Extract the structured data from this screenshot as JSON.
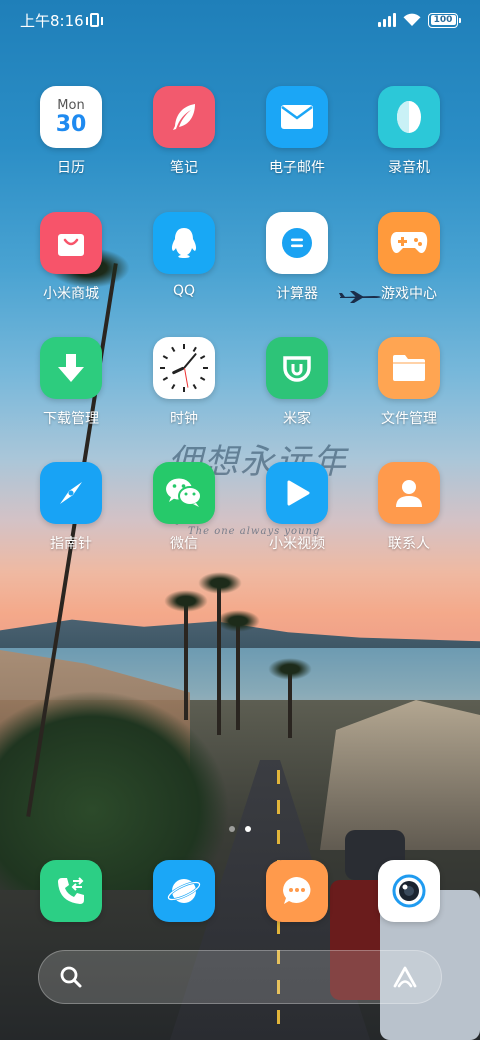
{
  "status_bar": {
    "time": "上午8:16",
    "battery": "100"
  },
  "apps": {
    "row1": [
      {
        "label": "日历",
        "icon": "calendar-icon",
        "color": "#ffffff"
      },
      {
        "label": "笔记",
        "icon": "feather-icon",
        "color": "#f25a6e"
      },
      {
        "label": "电子邮件",
        "icon": "envelope-icon",
        "color": "#1ba6f6"
      },
      {
        "label": "录音机",
        "icon": "recorder-icon",
        "color": "#2cc8d8"
      }
    ],
    "row2": [
      {
        "label": "小米商城",
        "icon": "shopping-bag-icon",
        "color": "#f7546a"
      },
      {
        "label": "QQ",
        "icon": "penguin-icon",
        "color": "#18a8f5"
      },
      {
        "label": "计算器",
        "icon": "equals-icon",
        "color": "#ffffff"
      },
      {
        "label": "游戏中心",
        "icon": "gamepad-icon",
        "color": "#ff9a3c"
      }
    ],
    "row3": [
      {
        "label": "下载管理",
        "icon": "download-arrow-icon",
        "color": "#2dcc7e"
      },
      {
        "label": "时钟",
        "icon": "clock-icon",
        "color": "#ffffff"
      },
      {
        "label": "米家",
        "icon": "mijia-icon",
        "color": "#2dc478"
      },
      {
        "label": "文件管理",
        "icon": "folder-icon",
        "color": "#ffa552"
      }
    ],
    "row4": [
      {
        "label": "指南针",
        "icon": "compass-icon",
        "color": "#18a3f5"
      },
      {
        "label": "微信",
        "icon": "wechat-icon",
        "color": "#26c96a"
      },
      {
        "label": "小米视频",
        "icon": "play-icon",
        "color": "#1aa7f6"
      },
      {
        "label": "联系人",
        "icon": "contact-person-icon",
        "color": "#ff9a4c"
      }
    ]
  },
  "calendar_icon": {
    "weekday": "Mon",
    "day": "30"
  },
  "dock": [
    {
      "icon": "phone-icon",
      "color": "#2ccf85"
    },
    {
      "icon": "browser-planet-icon",
      "color": "#1ba7f7"
    },
    {
      "icon": "message-bubble-icon",
      "color": "#ff9a4c"
    },
    {
      "icon": "camera-icon",
      "color": "#ffffff"
    }
  ],
  "search_bar": {
    "left_icon": "search-icon",
    "right_icon": "assistant-icon"
  },
  "page_indicator": {
    "pages": 2,
    "current": 2
  },
  "wallpaper_watermark": {
    "title": "佣想永远年轻",
    "subtitle": "The one always young"
  }
}
